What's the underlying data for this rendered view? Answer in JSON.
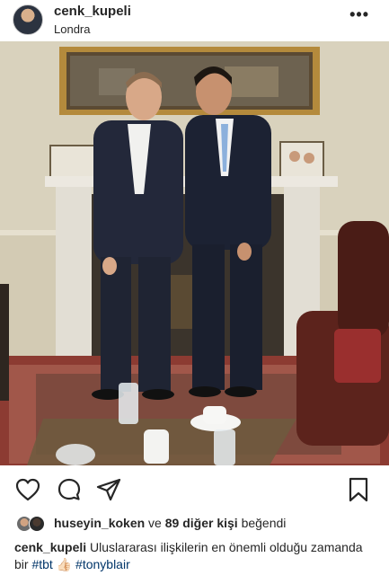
{
  "post": {
    "username": "cenk_kupeli",
    "location": "Londra",
    "more_label": "•••"
  },
  "icons": {
    "like": "heart-outline-icon",
    "comment": "comment-bubble-icon",
    "share": "paper-plane-icon",
    "save": "bookmark-outline-icon"
  },
  "likes": {
    "liker": "huseyin_koken",
    "connector": "ve",
    "others": "89 diğer kişi",
    "suffix": "beğendi"
  },
  "caption": {
    "author": "cenk_kupeli",
    "text": "Uluslararası ilişkilerin en önemli olduğu zamanda bir",
    "hashtag1": "#tbt",
    "emoji": "👍🏻",
    "hashtag2": "#tonyblair"
  },
  "colors": {
    "text": "#262626",
    "hashtag": "#003569",
    "background": "#ffffff"
  }
}
